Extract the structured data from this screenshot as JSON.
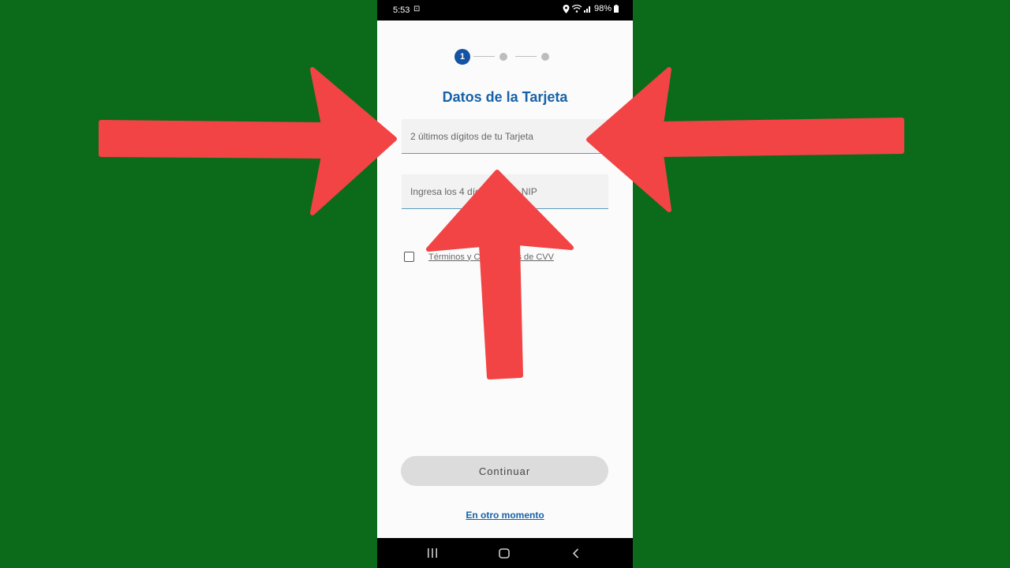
{
  "status_bar": {
    "time": "5:53",
    "battery": "98%"
  },
  "stepper": {
    "active_step": "1",
    "total_steps": 3
  },
  "form": {
    "title": "Datos de la Tarjeta",
    "card_digits_placeholder": "2 últimos dígitos de tu Tarjeta",
    "nip_placeholder": "Ingresa los 4 dígitos de tu NIP",
    "terms_label": "Términos y Condiciones de CVV",
    "continue_label": "Continuar",
    "later_label": "En otro momento"
  },
  "colors": {
    "background": "#0b6b1a",
    "accent": "#1662a8",
    "arrow": "#f24444"
  },
  "icons": [
    "location-icon",
    "wifi-icon",
    "signal-icon",
    "battery-icon",
    "recents-icon",
    "home-icon",
    "back-icon"
  ]
}
